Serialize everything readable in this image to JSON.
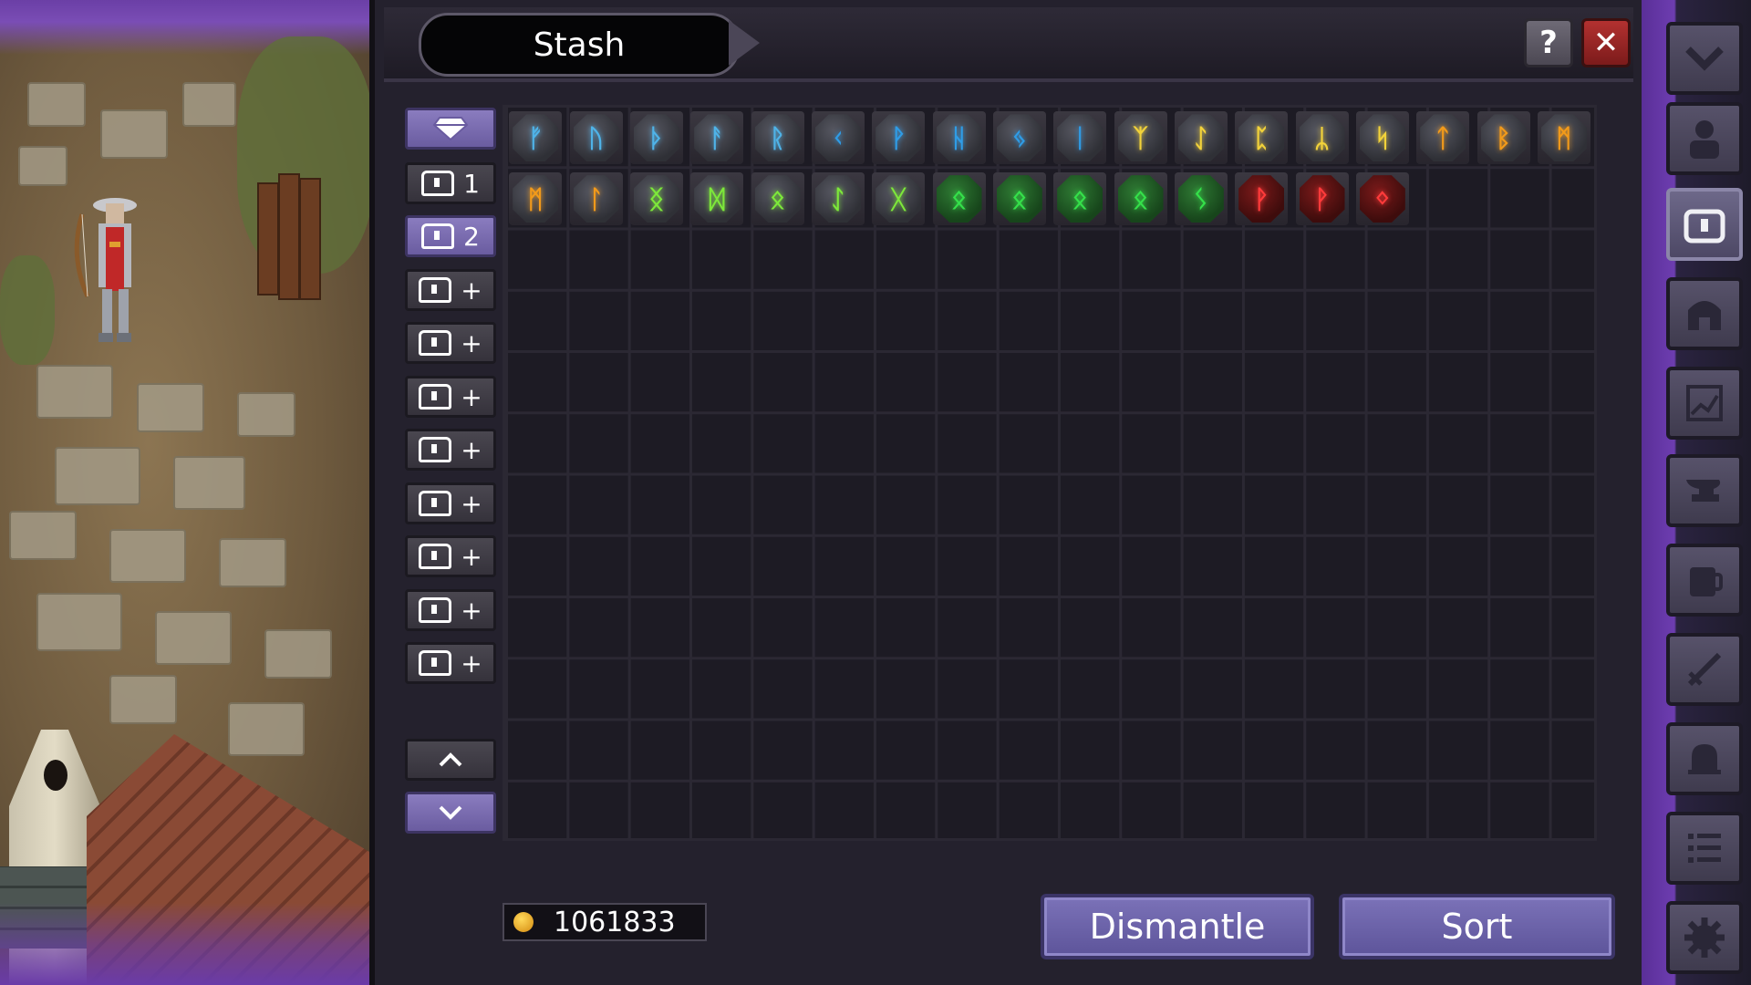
{
  "stash": {
    "title": "Stash",
    "help_label": "?",
    "close_label": "✕"
  },
  "tabs": [
    {
      "label": "",
      "icon": "gem-icon"
    },
    {
      "label": "1",
      "icon": "chest-icon"
    },
    {
      "label": "2",
      "icon": "chest-icon"
    },
    {
      "label": "+",
      "icon": "chest-icon"
    },
    {
      "label": "+",
      "icon": "chest-icon"
    },
    {
      "label": "+",
      "icon": "chest-icon"
    },
    {
      "label": "+",
      "icon": "chest-icon"
    },
    {
      "label": "+",
      "icon": "chest-icon"
    },
    {
      "label": "+",
      "icon": "chest-icon"
    },
    {
      "label": "+",
      "icon": "chest-icon"
    },
    {
      "label": "+",
      "icon": "chest-icon"
    }
  ],
  "grid": {
    "columns": 18,
    "rows": 12,
    "runes": [
      {
        "glyph": "ᚠ",
        "color": "#4fb3e8",
        "tier": "blue"
      },
      {
        "glyph": "ᚢ",
        "color": "#4fb3e8",
        "tier": "blue"
      },
      {
        "glyph": "ᚦ",
        "color": "#4fb3e8",
        "tier": "blue"
      },
      {
        "glyph": "ᚨ",
        "color": "#4fb3e8",
        "tier": "blue"
      },
      {
        "glyph": "ᚱ",
        "color": "#4fb3e8",
        "tier": "blue"
      },
      {
        "glyph": "ᚲ",
        "color": "#2f9ce6",
        "tier": "blue"
      },
      {
        "glyph": "ᚹ",
        "color": "#2f9ce6",
        "tier": "blue"
      },
      {
        "glyph": "ᚺ",
        "color": "#2f9ce6",
        "tier": "blue"
      },
      {
        "glyph": "ᛃ",
        "color": "#2f9ce6",
        "tier": "blue"
      },
      {
        "glyph": "ᛁ",
        "color": "#2f9ce6",
        "tier": "blue"
      },
      {
        "glyph": "ᛉ",
        "color": "#f2d23a",
        "tier": "yellow"
      },
      {
        "glyph": "ᛇ",
        "color": "#f2d23a",
        "tier": "yellow"
      },
      {
        "glyph": "ᛈ",
        "color": "#f2d23a",
        "tier": "yellow"
      },
      {
        "glyph": "ᛦ",
        "color": "#f2d23a",
        "tier": "yellow"
      },
      {
        "glyph": "ᛋ",
        "color": "#f2d23a",
        "tier": "yellow"
      },
      {
        "glyph": "ᛏ",
        "color": "#f29a1a",
        "tier": "orange"
      },
      {
        "glyph": "ᛒ",
        "color": "#f29a1a",
        "tier": "orange"
      },
      {
        "glyph": "ᛗ",
        "color": "#f29a1a",
        "tier": "orange"
      },
      {
        "glyph": "ᛗ",
        "color": "#f29a1a",
        "tier": "orange"
      },
      {
        "glyph": "ᛚ",
        "color": "#f29a1a",
        "tier": "orange"
      },
      {
        "glyph": "ᛝ",
        "color": "#7de83a",
        "tier": "lime"
      },
      {
        "glyph": "ᛞ",
        "color": "#7de83a",
        "tier": "lime"
      },
      {
        "glyph": "ᛟ",
        "color": "#7de83a",
        "tier": "lime"
      },
      {
        "glyph": "ᛇ",
        "color": "#7de83a",
        "tier": "lime"
      },
      {
        "glyph": "ᚷ",
        "color": "#7de83a",
        "tier": "lime"
      },
      {
        "glyph": "ᛟ",
        "color": "#35e04a",
        "tier": "green"
      },
      {
        "glyph": "ᛟ",
        "color": "#35e04a",
        "tier": "green"
      },
      {
        "glyph": "ᛟ",
        "color": "#35e04a",
        "tier": "green"
      },
      {
        "glyph": "ᛟ",
        "color": "#35e04a",
        "tier": "green"
      },
      {
        "glyph": "ᛊ",
        "color": "#35e04a",
        "tier": "green"
      },
      {
        "glyph": "ᚹ",
        "color": "#ff3b3b",
        "tier": "red"
      },
      {
        "glyph": "ᚹ",
        "color": "#ff3b3b",
        "tier": "red"
      },
      {
        "glyph": "ᛜ",
        "color": "#ff3b3b",
        "tier": "red"
      }
    ]
  },
  "footer": {
    "gold_icon": "coin-icon",
    "gold_amount": "1061833",
    "dismantle_label": "Dismantle",
    "sort_label": "Sort"
  },
  "sidebar": {
    "buttons": [
      {
        "name": "collapse-chevron",
        "active": false
      },
      {
        "name": "character",
        "active": false
      },
      {
        "name": "stash",
        "active": true
      },
      {
        "name": "helmet",
        "active": false
      },
      {
        "name": "stats",
        "active": false
      },
      {
        "name": "anvil",
        "active": false
      },
      {
        "name": "potion",
        "active": false
      },
      {
        "name": "sword",
        "active": false
      },
      {
        "name": "bell",
        "active": false
      },
      {
        "name": "checklist",
        "active": false
      },
      {
        "name": "settings",
        "active": false
      }
    ]
  }
}
